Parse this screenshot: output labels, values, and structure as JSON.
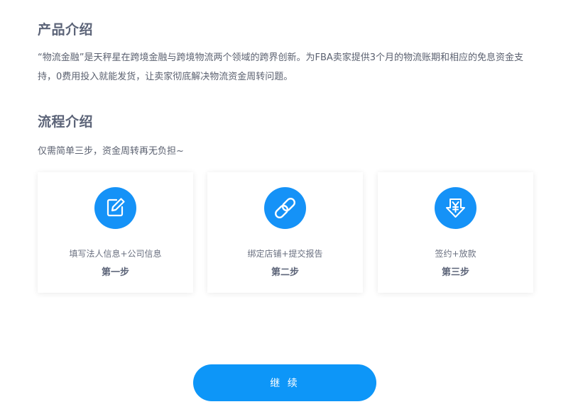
{
  "product": {
    "title": "产品介绍",
    "description": "“物流金融”是天秤星在跨境金融与跨境物流两个领域的跨界创新。为FBA卖家提供3个月的物流账期和相应的免息资金支持，0费用投入就能发货，让卖家彻底解决物流资金周转问题。"
  },
  "process": {
    "title": "流程介绍",
    "subtitle": "仅需简单三步，资金周转再无负担~",
    "steps": [
      {
        "icon": "edit-icon",
        "label": "填写法人信息+公司信息",
        "step": "第一步"
      },
      {
        "icon": "link-icon",
        "label": "绑定店铺+提交报告",
        "step": "第二步"
      },
      {
        "icon": "yen-download-icon",
        "label": "签约+放款",
        "step": "第三步"
      }
    ]
  },
  "actions": {
    "continue_label": "继 续"
  },
  "colors": {
    "accent": "#1592f7",
    "button": "#0d96f8",
    "title": "#5c6478",
    "text": "#5b6170"
  }
}
